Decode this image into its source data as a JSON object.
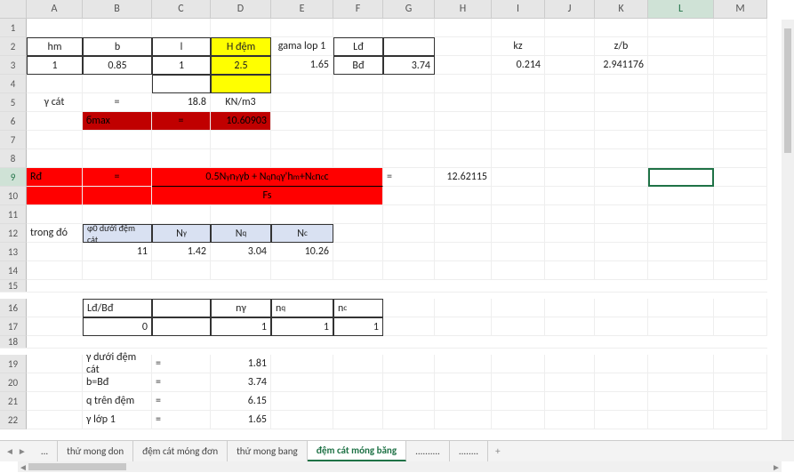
{
  "columns": [
    "A",
    "B",
    "C",
    "D",
    "E",
    "F",
    "G",
    "H",
    "I",
    "J",
    "K",
    "L",
    "M"
  ],
  "rows": [
    "1",
    "2",
    "3",
    "4",
    "5",
    "6",
    "7",
    "8",
    "9",
    "10",
    "11",
    "12",
    "13",
    "14",
    "15",
    "16",
    "17",
    "18",
    "19",
    "20",
    "21",
    "22"
  ],
  "r2": {
    "A": "hm",
    "B": "b",
    "C": "l",
    "D": "H đệm",
    "E": "gama lop 1",
    "F": "Lđ",
    "I": "kz",
    "K": "z/b"
  },
  "r3": {
    "A": "1",
    "B": "0.85",
    "C": "1",
    "D": "2.5",
    "E": "1.65",
    "F": "Bđ",
    "G": "3.74",
    "I": "0.214",
    "K": "2.941176"
  },
  "r5": {
    "A": "γ cát",
    "B": "=",
    "C": "18.8",
    "D": "KN/m3"
  },
  "r6": {
    "B": "ϭmax",
    "C": "=",
    "D": "10.60903"
  },
  "r9": {
    "A": "Rđ",
    "B": "=",
    "formula": "0.5Nγnγγb + Nqnqγ'hm +Ncncc",
    "G": "=",
    "H": "12.62115"
  },
  "r10": {
    "fs": "Fs"
  },
  "r12": {
    "A": "trong đó",
    "B": "φ0 dưới đệm cát",
    "C": "Nγ",
    "D": "Nq",
    "E": "Nc"
  },
  "r13": {
    "B": "11",
    "C": "1.42",
    "D": "3.04",
    "E": "10.26"
  },
  "r16": {
    "B": "Lđ/Bđ",
    "D": "nγ",
    "E": "nq",
    "F": "nc"
  },
  "r17": {
    "B": "0",
    "D": "1",
    "E": "1",
    "F": "1"
  },
  "r19": {
    "B": "γ dưới đệm cát",
    "C": "=",
    "D": "1.81"
  },
  "r20": {
    "B": "b=Bđ",
    "C": "=",
    "D": "3.74"
  },
  "r21": {
    "B": "q trên đệm",
    "C": "=",
    "D": "6.15"
  },
  "r22": {
    "B": "γ lớp 1",
    "C": "=",
    "D": "1.65"
  },
  "tabs": {
    "dots": "...",
    "t1": "thử mong don",
    "t2": "đệm cát móng đơn",
    "t3": "thử mong bang",
    "t4": "đệm cát móng băng",
    "t5": "..........",
    "t6": "........"
  },
  "icons": {
    "add": "+",
    "left": "◄",
    "right": "►",
    "down": "▼"
  }
}
